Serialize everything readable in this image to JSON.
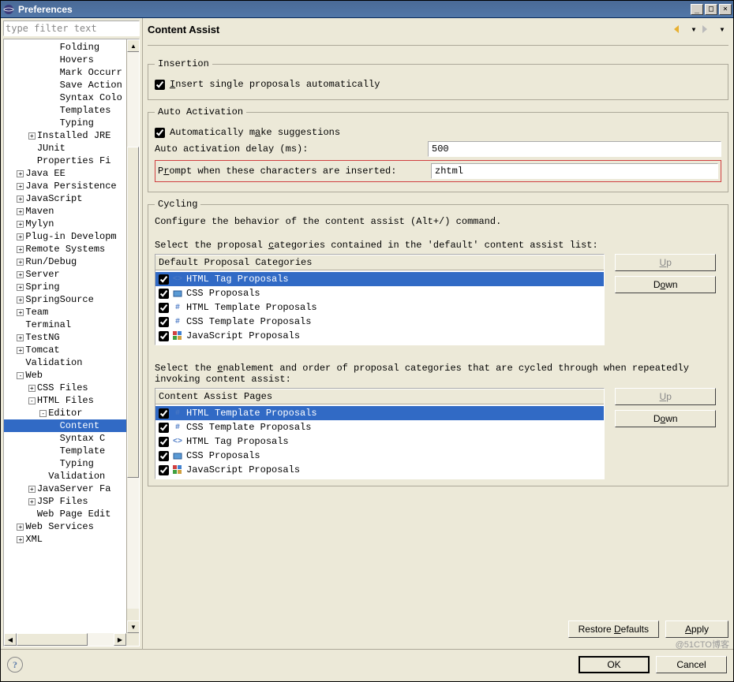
{
  "window": {
    "title": "Preferences"
  },
  "filter_placeholder": "type filter text",
  "page_title": "Content Assist",
  "tree": [
    {
      "indent": 4,
      "label": "Folding"
    },
    {
      "indent": 4,
      "label": "Hovers"
    },
    {
      "indent": 4,
      "label": "Mark Occurr"
    },
    {
      "indent": 4,
      "label": "Save Action"
    },
    {
      "indent": 4,
      "label": "Syntax Colo"
    },
    {
      "indent": 4,
      "label": "Templates"
    },
    {
      "indent": 4,
      "label": "Typing"
    },
    {
      "indent": 2,
      "expand": "+",
      "label": "Installed JRE"
    },
    {
      "indent": 2,
      "label": "JUnit"
    },
    {
      "indent": 2,
      "label": "Properties Fi"
    },
    {
      "indent": 1,
      "expand": "+",
      "label": "Java EE"
    },
    {
      "indent": 1,
      "expand": "+",
      "label": "Java Persistence"
    },
    {
      "indent": 1,
      "expand": "+",
      "label": "JavaScript"
    },
    {
      "indent": 1,
      "expand": "+",
      "label": "Maven"
    },
    {
      "indent": 1,
      "expand": "+",
      "label": "Mylyn"
    },
    {
      "indent": 1,
      "expand": "+",
      "label": "Plug-in Developm"
    },
    {
      "indent": 1,
      "expand": "+",
      "label": "Remote Systems"
    },
    {
      "indent": 1,
      "expand": "+",
      "label": "Run/Debug"
    },
    {
      "indent": 1,
      "expand": "+",
      "label": "Server"
    },
    {
      "indent": 1,
      "expand": "+",
      "label": "Spring"
    },
    {
      "indent": 1,
      "expand": "+",
      "label": "SpringSource"
    },
    {
      "indent": 1,
      "expand": "+",
      "label": "Team"
    },
    {
      "indent": 1,
      "label": "Terminal"
    },
    {
      "indent": 1,
      "expand": "+",
      "label": "TestNG"
    },
    {
      "indent": 1,
      "expand": "+",
      "label": "Tomcat"
    },
    {
      "indent": 1,
      "label": "Validation"
    },
    {
      "indent": 1,
      "expand": "-",
      "label": "Web"
    },
    {
      "indent": 2,
      "expand": "+",
      "label": "CSS Files"
    },
    {
      "indent": 2,
      "expand": "-",
      "label": "HTML Files"
    },
    {
      "indent": 3,
      "expand": "-",
      "label": "Editor"
    },
    {
      "indent": 4,
      "label": "Content",
      "selected": true
    },
    {
      "indent": 4,
      "label": "Syntax C"
    },
    {
      "indent": 4,
      "label": "Template"
    },
    {
      "indent": 4,
      "label": "Typing"
    },
    {
      "indent": 3,
      "label": "Validation"
    },
    {
      "indent": 2,
      "expand": "+",
      "label": "JavaServer Fa"
    },
    {
      "indent": 2,
      "expand": "+",
      "label": "JSP Files"
    },
    {
      "indent": 2,
      "label": "Web Page Edit"
    },
    {
      "indent": 1,
      "expand": "+",
      "label": "Web Services"
    },
    {
      "indent": 1,
      "expand": "+",
      "label": "XML"
    }
  ],
  "insertion": {
    "legend": "Insertion",
    "cb1_pre": "",
    "cb1_u": "I",
    "cb1_post": "nsert single proposals automatically",
    "cb1_checked": true
  },
  "auto": {
    "legend": "Auto Activation",
    "cb_pre": "Automatically m",
    "cb_u": "a",
    "cb_post": "ke suggestions",
    "cb_checked": true,
    "delay_label": "Auto activation delay (ms):",
    "delay_value": "500",
    "prompt_pre": "P",
    "prompt_u": "r",
    "prompt_post": "ompt when these characters are inserted:",
    "prompt_value": "zhtml"
  },
  "cycling": {
    "legend": "Cycling",
    "desc": "Configure the behavior of the content assist (Alt+/) command.",
    "sel1_pre": "Select the proposal ",
    "sel1_u": "c",
    "sel1_post": "ategories contained in the 'default' content assist list:",
    "list1_header": "Default Proposal Categories",
    "list1": [
      {
        "checked": true,
        "icon": "<>",
        "iconname": "tag-icon",
        "label": "HTML Tag Proposals",
        "sel": true
      },
      {
        "checked": true,
        "icon": "css",
        "iconname": "css-icon",
        "label": "CSS Proposals"
      },
      {
        "checked": true,
        "icon": "#",
        "iconname": "hash-icon",
        "label": "HTML Template Proposals"
      },
      {
        "checked": true,
        "icon": "#",
        "iconname": "hash-icon",
        "label": "CSS Template Proposals"
      },
      {
        "checked": true,
        "icon": "js",
        "iconname": "js-icon",
        "label": "JavaScript Proposals"
      }
    ],
    "sel2_pre": "Select the ",
    "sel2_u": "e",
    "sel2_post": "nablement and order of proposal categories that are cycled through when repeatedly invoking content assist:",
    "list2_header": "Content Assist Pages",
    "list2": [
      {
        "checked": true,
        "icon": "#",
        "iconname": "hash-icon",
        "label": "HTML Template Proposals",
        "sel": true
      },
      {
        "checked": true,
        "icon": "#",
        "iconname": "hash-icon",
        "label": "CSS Template Proposals"
      },
      {
        "checked": true,
        "icon": "<>",
        "iconname": "tag-icon",
        "label": "HTML Tag Proposals"
      },
      {
        "checked": true,
        "icon": "css",
        "iconname": "css-icon",
        "label": "CSS Proposals"
      },
      {
        "checked": true,
        "icon": "js",
        "iconname": "js-icon",
        "label": "JavaScript Proposals"
      }
    ],
    "up_u": "U",
    "up_post": "p",
    "down_pre": "D",
    "down_u": "o",
    "down_post": "wn"
  },
  "buttons": {
    "restore_pre": "Restore ",
    "restore_u": "D",
    "restore_post": "efaults",
    "apply_u": "A",
    "apply_post": "pply",
    "ok": "OK",
    "cancel": "Cancel"
  },
  "watermark": "@51CTO博客"
}
